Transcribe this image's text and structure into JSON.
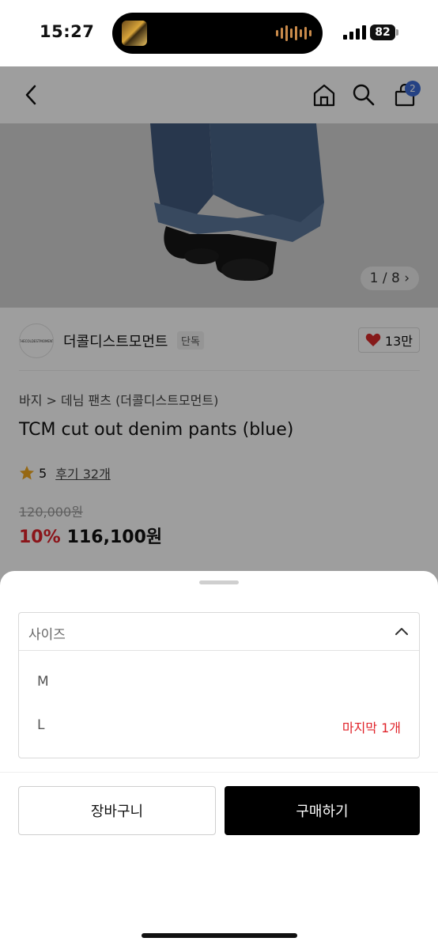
{
  "status_bar": {
    "time": "15:27",
    "battery": "82"
  },
  "header": {
    "cart_count": "2"
  },
  "gallery": {
    "counter": "1 / 8"
  },
  "brand": {
    "name": "더콜디스트모먼트",
    "tag": "단독",
    "likes": "13만",
    "logo_text": "THECOLDESTMOMENT"
  },
  "product": {
    "breadcrumb": "바지 > 데님 팬츠 (더콜디스트모먼트)",
    "title": "TCM cut out denim pants (blue)",
    "rating": "5",
    "reviews": "후기 32개",
    "original_price": "120,000원",
    "discount": "10%",
    "sale_price": "116,100원"
  },
  "sheet": {
    "size_placeholder": "사이즈",
    "options": [
      {
        "label": "M",
        "note": ""
      },
      {
        "label": "L",
        "note": "마지막 1개"
      }
    ],
    "cart_label": "장바구니",
    "buy_label": "구매하기"
  },
  "colors": {
    "accent_red": "#e0232a",
    "badge_blue": "#3d6bd6",
    "buy_button": "#000000"
  }
}
